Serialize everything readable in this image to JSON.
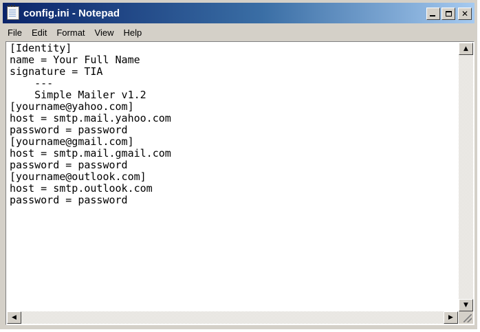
{
  "window": {
    "title": "config.ini - Notepad"
  },
  "menu": {
    "items": [
      "File",
      "Edit",
      "Format",
      "View",
      "Help"
    ]
  },
  "editor": {
    "content": "[Identity]\nname = Your Full Name\nsignature = TIA\n    ---\n    Simple Mailer v1.2\n[yourname@yahoo.com]\nhost = smtp.mail.yahoo.com\npassword = password\n[yourname@gmail.com]\nhost = smtp.mail.gmail.com\npassword = password\n[yourname@outlook.com]\nhost = smtp.outlook.com\npassword = password"
  },
  "icons": {
    "app": "notepad-icon",
    "minimize": "minimize-icon",
    "maximize": "maximize-icon",
    "close": "close-icon",
    "scroll_up": "arrow-up-icon",
    "scroll_down": "arrow-down-icon",
    "scroll_left": "arrow-left-icon",
    "scroll_right": "arrow-right-icon"
  },
  "colors": {
    "titlebar_start": "#0a246a",
    "titlebar_end": "#a6caf0",
    "chrome": "#d4d0c8"
  }
}
